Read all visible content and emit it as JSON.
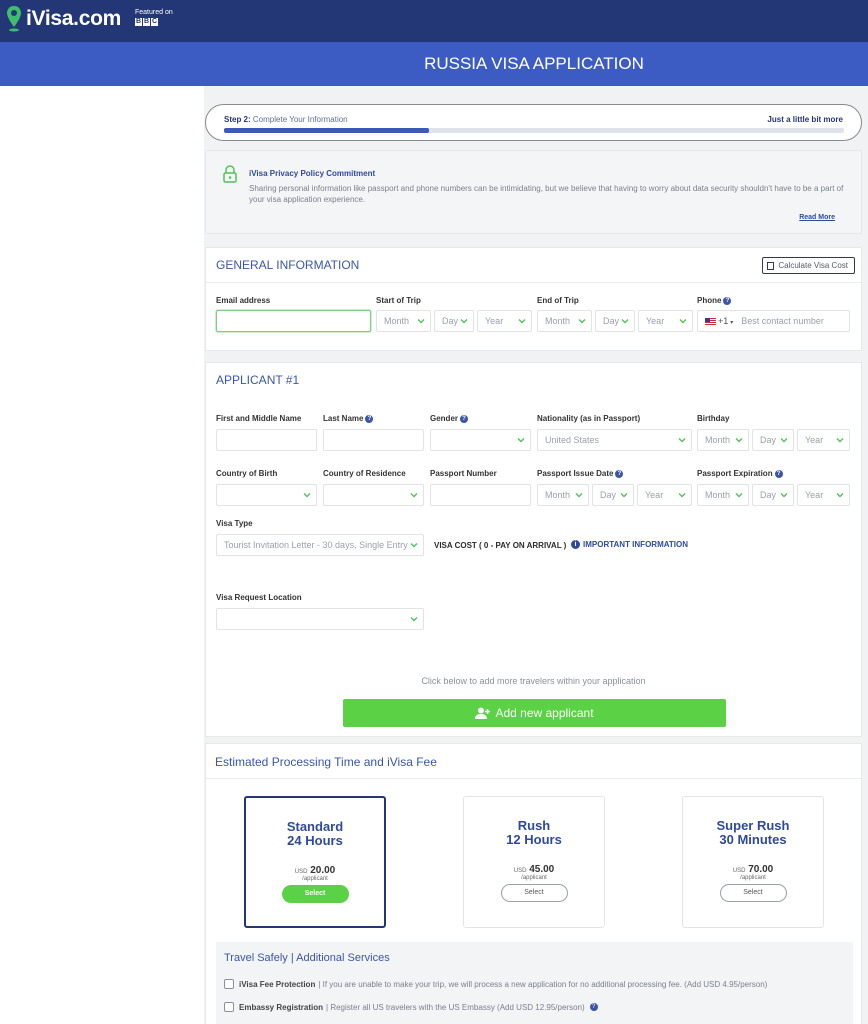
{
  "brand": {
    "name": "iVisa.com",
    "featured_on": "Featured on",
    "bbc": [
      "B",
      "B",
      "C"
    ]
  },
  "banner": {
    "title": "RUSSIA VISA APPLICATION"
  },
  "step": {
    "step_prefix": "Step 2:",
    "label": "Complete Your Information",
    "right": "Just a little bit more",
    "progress": 0.33
  },
  "privacy": {
    "title": "iVisa Privacy Policy Commitment",
    "text": "Sharing personal information like passport and phone numbers can be intimidating, but we believe that having to worry about data security shouldn't have to be a part of your visa application experience.",
    "read_more": "Read More"
  },
  "general": {
    "title": "GENERAL INFORMATION",
    "calc_button": "Calculate Visa Cost",
    "email_label": "Email address",
    "email_value": "",
    "start_label": "Start of Trip",
    "end_label": "End of Trip",
    "phone_label": "Phone",
    "month": "Month",
    "day": "Day",
    "year": "Year",
    "phone_code": "+1",
    "phone_placeholder": "Best contact number"
  },
  "applicant": {
    "title": "APPLICANT #1",
    "first_name_label": "First and Middle Name",
    "last_name_label": "Last Name",
    "gender_label": "Gender",
    "nationality_label": "Nationality (as in Passport)",
    "nationality_value": "United States",
    "birthday_label": "Birthday",
    "country_birth_label": "Country of Birth",
    "country_residence_label": "Country of Residence",
    "passport_number_label": "Passport Number",
    "issue_date_label": "Passport Issue Date",
    "expiration_label": "Passport Expiration",
    "visa_type_label": "Visa Type",
    "visa_type_value": "Tourist Invitation Letter - 30 days, Single Entry",
    "visa_cost": "VISA COST ( 0 - PAY ON ARRIVAL )",
    "important_info": "IMPORTANT INFORMATION",
    "request_location_label": "Visa Request Location",
    "add_hint": "Click below to add more travelers within your application",
    "add_button": "Add new applicant"
  },
  "processing": {
    "title": "Estimated Processing Time and iVisa Fee",
    "plans": [
      {
        "line1": "Standard",
        "line2": "24 Hours",
        "currency": "USD",
        "price": "20.00",
        "per": "/applicant",
        "button": "Select",
        "selected": true
      },
      {
        "line1": "Rush",
        "line2": "12 Hours",
        "currency": "USD",
        "price": "45.00",
        "per": "/applicant",
        "button": "Select",
        "selected": false
      },
      {
        "line1": "Super Rush",
        "line2": "30 Minutes",
        "currency": "USD",
        "price": "70.00",
        "per": "/applicant",
        "button": "Select",
        "selected": false
      }
    ]
  },
  "services": {
    "title": "Travel Safely | Additional Services",
    "items": [
      {
        "name": "iVisa Fee Protection",
        "desc": "| If you are unable to make your trip, we will process a new application for no additional processing fee. (Add USD 4.95/person)"
      },
      {
        "name": "Embassy Registration",
        "desc": "| Register all US travelers with the US Embassy (Add USD 12.95/person)"
      }
    ]
  },
  "colors": {
    "navy": "#233676",
    "blue": "#3c5cc4",
    "green": "#5bd145"
  }
}
